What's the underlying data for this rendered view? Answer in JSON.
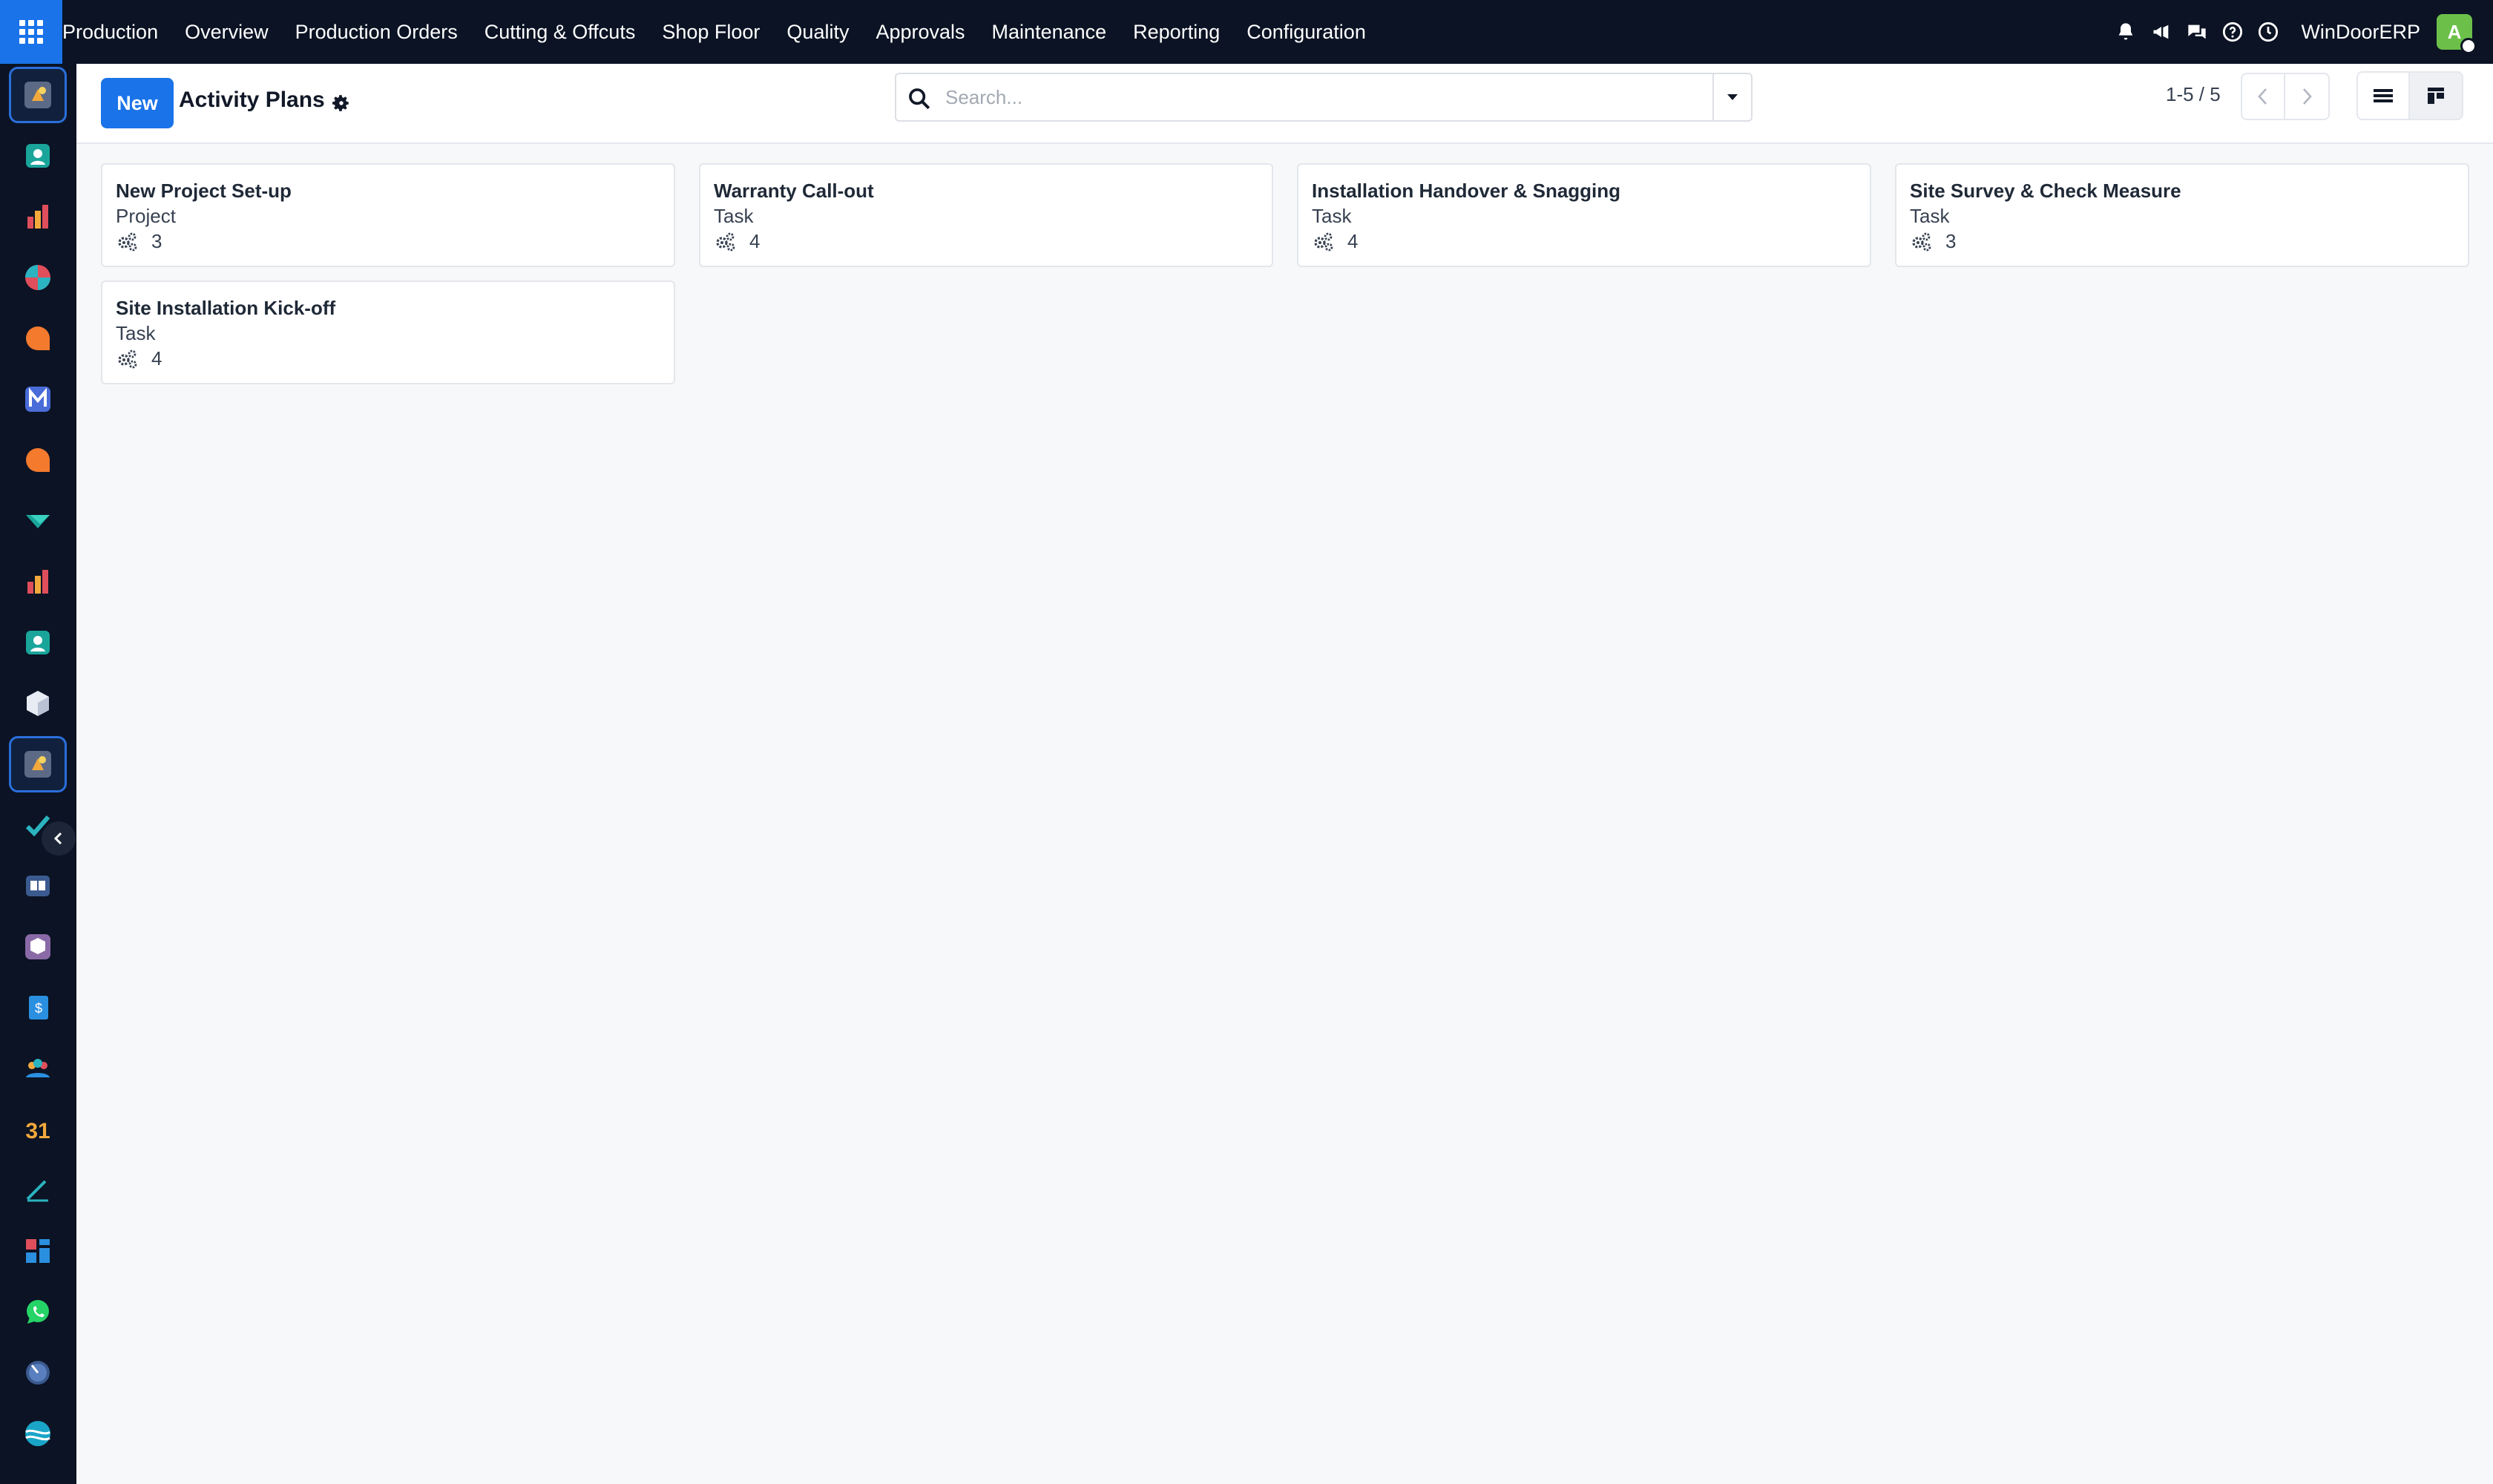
{
  "topbar": {
    "menu": [
      "Production",
      "Overview",
      "Production Orders",
      "Cutting & Offcuts",
      "Shop Floor",
      "Quality",
      "Approvals",
      "Maintenance",
      "Reporting",
      "Configuration"
    ],
    "company": "WinDoorERP",
    "avatar_initial": "A"
  },
  "control_panel": {
    "new_label": "New",
    "title": "Activity Plans",
    "search_placeholder": "Search...",
    "pager": "1-5 / 5"
  },
  "cards": [
    {
      "title": "New Project Set-up",
      "type": "Project",
      "count": "3"
    },
    {
      "title": "Warranty Call-out",
      "type": "Task",
      "count": "4"
    },
    {
      "title": "Installation Handover & Snagging",
      "type": "Task",
      "count": "4"
    },
    {
      "title": "Site Survey & Check Measure",
      "type": "Task",
      "count": "3"
    },
    {
      "title": "Site Installation Kick-off",
      "type": "Task",
      "count": "4"
    }
  ],
  "colors": {
    "navbar": "#0b1324",
    "primary": "#1a73e8",
    "background": "#f7f8fa",
    "avatar": "#6cc04a"
  }
}
